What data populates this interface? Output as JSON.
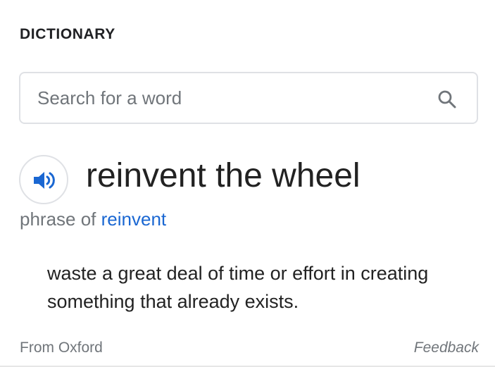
{
  "panel": {
    "title": "DICTIONARY"
  },
  "search": {
    "placeholder": "Search for a word",
    "value": ""
  },
  "entry": {
    "headword": "reinvent the wheel",
    "phrase_prefix": "phrase of ",
    "phrase_of": "reinvent",
    "definition": "waste a great deal of time or effort in creating something that already exists."
  },
  "footer": {
    "source": "From Oxford",
    "feedback": "Feedback"
  },
  "icons": {
    "search": "search-icon",
    "speaker": "speaker-icon"
  },
  "colors": {
    "accent": "#1a67d2",
    "text": "#222222",
    "muted": "#70757a",
    "border": "#dfe1e5"
  }
}
